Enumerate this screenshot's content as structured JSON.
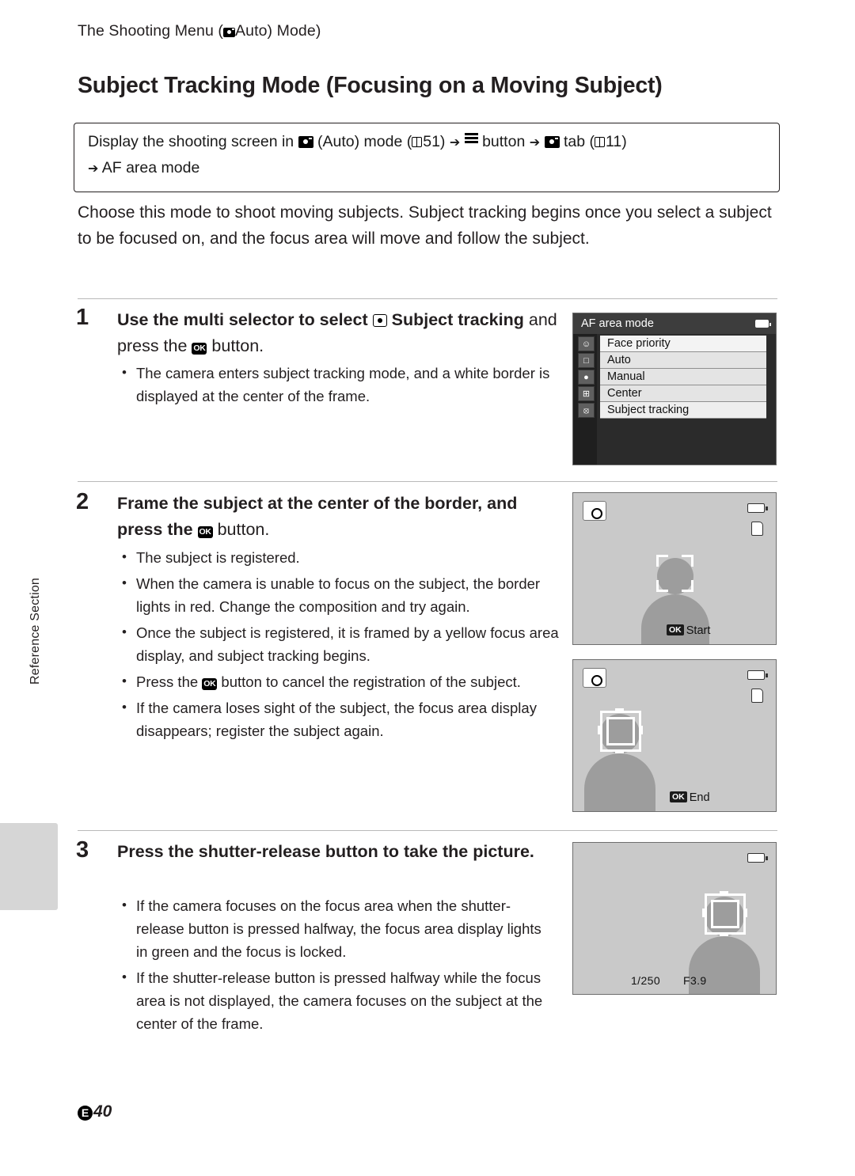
{
  "header": {
    "text_before": "The Shooting Menu (",
    "text_after": "Auto) Mode)"
  },
  "page_title": "Subject Tracking Mode (Focusing on a Moving Subject)",
  "navbox": {
    "line1_a": "Display the shooting screen in",
    "line1_b": "(Auto) mode (",
    "line1_ref1": "51)",
    "line1_c": "button",
    "line1_d": "tab (",
    "line1_ref2": "11)",
    "menu_label": "MENU",
    "line2": "AF area mode"
  },
  "intro": "Choose this mode to shoot moving subjects. Subject tracking begins once you select a subject to be focused on, and the focus area will move and follow the subject.",
  "steps": [
    {
      "num": "1",
      "title_a": "Use the multi selector to select",
      "title_bold": "Subject tracking",
      "title_b": "and press the",
      "title_c": "button.",
      "bullets": [
        "The camera enters subject tracking mode, and a white border is displayed at the center of the frame."
      ]
    },
    {
      "num": "2",
      "title_a": "Frame the subject at the center of the border, and press the",
      "title_c": "button.",
      "bullets": [
        "The subject is registered.",
        "When the camera is unable to focus on the subject, the border lights in red. Change the composition and try again.",
        "Once the subject is registered, it is framed by a yellow focus area display, and subject tracking begins.",
        "Press the  button to cancel the registration of the subject.",
        "If the camera loses sight of the subject, the focus area display disappears; register the subject again."
      ]
    },
    {
      "num": "3",
      "title_a": "Press the shutter-release button to take the picture.",
      "bullets": [
        "If the camera focuses on the focus area when the shutter-release button is pressed halfway, the focus area display lights in green and the focus is locked.",
        "If the shutter-release button is pressed halfway while the focus area is not displayed, the camera focuses on the subject at the center of the frame."
      ]
    }
  ],
  "menu_screen": {
    "title": "AF area mode",
    "items": [
      {
        "label": "Face priority",
        "icon": "face"
      },
      {
        "label": "Auto",
        "icon": "auto"
      },
      {
        "label": "Manual",
        "icon": "manual"
      },
      {
        "label": "Center",
        "icon": "center"
      },
      {
        "label": "Subject tracking",
        "icon": "tracking"
      }
    ]
  },
  "screen2": {
    "ok_label": "Start"
  },
  "screen3": {
    "ok_label": "End"
  },
  "screen4": {
    "shutter": "1/250",
    "aperture": "F3.9"
  },
  "side_tab_label": "Reference Section",
  "footer": {
    "mark": "E",
    "page": "40"
  }
}
